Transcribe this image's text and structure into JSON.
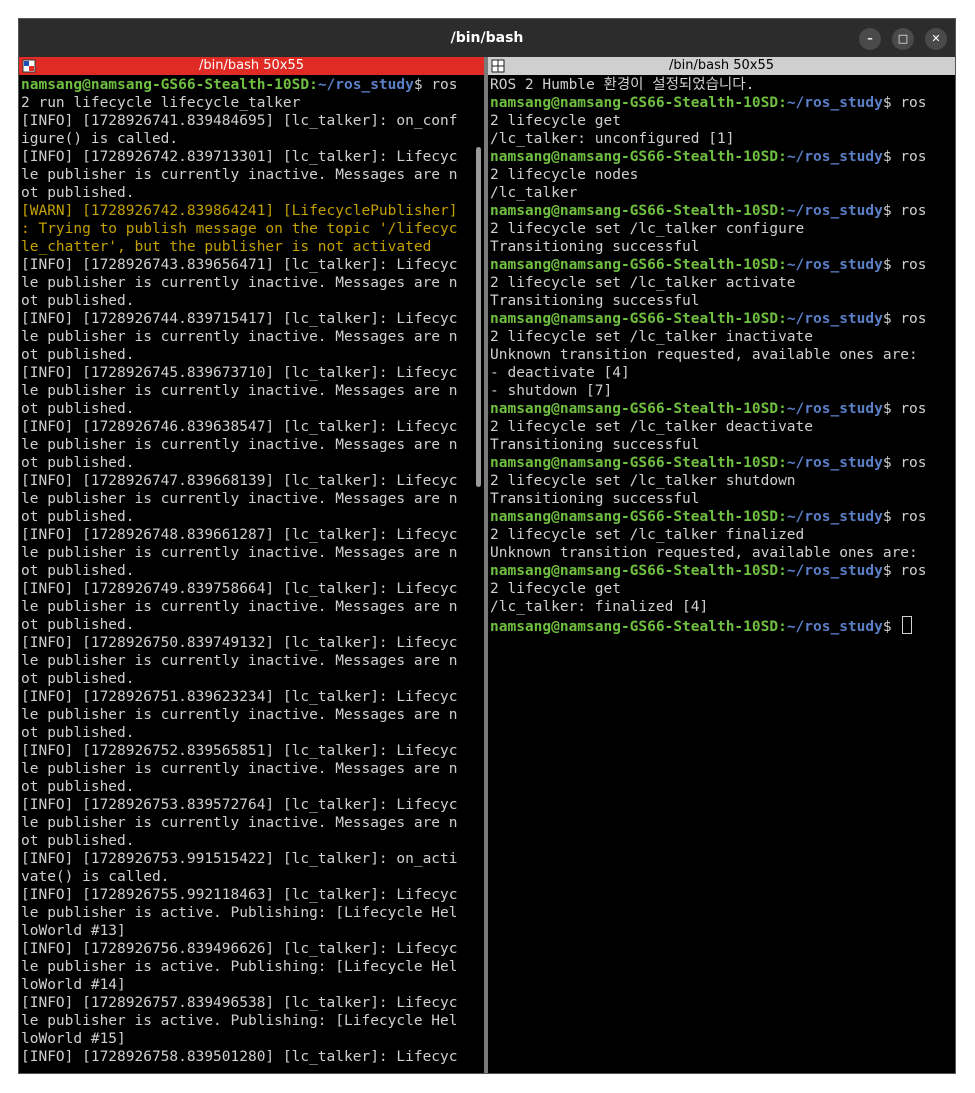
{
  "window": {
    "title": "/bin/bash",
    "buttons": {
      "minimize": "–",
      "maximize": "□",
      "close": "✕"
    }
  },
  "left_pane": {
    "header": "/bin/bash 50x55",
    "active": true,
    "lines": [
      {
        "type": "prompt",
        "user": "namsang@namsang-GS66-Stealth-10SD",
        "sep": ":",
        "path": "~/ros_study",
        "tail": "$ ros"
      },
      {
        "type": "info",
        "text": "2 run lifecycle lifecycle_talker"
      },
      {
        "type": "info",
        "text": "[INFO] [1728926741.839484695] [lc_talker]: on_conf"
      },
      {
        "type": "info",
        "text": "igure() is called."
      },
      {
        "type": "info",
        "text": "[INFO] [1728926742.839713301] [lc_talker]: Lifecyc"
      },
      {
        "type": "info",
        "text": "le publisher is currently inactive. Messages are n"
      },
      {
        "type": "info",
        "text": "ot published."
      },
      {
        "type": "warn",
        "text": "[WARN] [1728926742.839864241] [LifecyclePublisher]"
      },
      {
        "type": "warn",
        "text": ": Trying to publish message on the topic '/lifecyc"
      },
      {
        "type": "warn",
        "text": "le_chatter', but the publisher is not activated"
      },
      {
        "type": "info",
        "text": "[INFO] [1728926743.839656471] [lc_talker]: Lifecyc"
      },
      {
        "type": "info",
        "text": "le publisher is currently inactive. Messages are n"
      },
      {
        "type": "info",
        "text": "ot published."
      },
      {
        "type": "info",
        "text": "[INFO] [1728926744.839715417] [lc_talker]: Lifecyc"
      },
      {
        "type": "info",
        "text": "le publisher is currently inactive. Messages are n"
      },
      {
        "type": "info",
        "text": "ot published."
      },
      {
        "type": "info",
        "text": "[INFO] [1728926745.839673710] [lc_talker]: Lifecyc"
      },
      {
        "type": "info",
        "text": "le publisher is currently inactive. Messages are n"
      },
      {
        "type": "info",
        "text": "ot published."
      },
      {
        "type": "info",
        "text": "[INFO] [1728926746.839638547] [lc_talker]: Lifecyc"
      },
      {
        "type": "info",
        "text": "le publisher is currently inactive. Messages are n"
      },
      {
        "type": "info",
        "text": "ot published."
      },
      {
        "type": "info",
        "text": "[INFO] [1728926747.839668139] [lc_talker]: Lifecyc"
      },
      {
        "type": "info",
        "text": "le publisher is currently inactive. Messages are n"
      },
      {
        "type": "info",
        "text": "ot published."
      },
      {
        "type": "info",
        "text": "[INFO] [1728926748.839661287] [lc_talker]: Lifecyc"
      },
      {
        "type": "info",
        "text": "le publisher is currently inactive. Messages are n"
      },
      {
        "type": "info",
        "text": "ot published."
      },
      {
        "type": "info",
        "text": "[INFO] [1728926749.839758664] [lc_talker]: Lifecyc"
      },
      {
        "type": "info",
        "text": "le publisher is currently inactive. Messages are n"
      },
      {
        "type": "info",
        "text": "ot published."
      },
      {
        "type": "info",
        "text": "[INFO] [1728926750.839749132] [lc_talker]: Lifecyc"
      },
      {
        "type": "info",
        "text": "le publisher is currently inactive. Messages are n"
      },
      {
        "type": "info",
        "text": "ot published."
      },
      {
        "type": "info",
        "text": "[INFO] [1728926751.839623234] [lc_talker]: Lifecyc"
      },
      {
        "type": "info",
        "text": "le publisher is currently inactive. Messages are n"
      },
      {
        "type": "info",
        "text": "ot published."
      },
      {
        "type": "info",
        "text": "[INFO] [1728926752.839565851] [lc_talker]: Lifecyc"
      },
      {
        "type": "info",
        "text": "le publisher is currently inactive. Messages are n"
      },
      {
        "type": "info",
        "text": "ot published."
      },
      {
        "type": "info",
        "text": "[INFO] [1728926753.839572764] [lc_talker]: Lifecyc"
      },
      {
        "type": "info",
        "text": "le publisher is currently inactive. Messages are n"
      },
      {
        "type": "info",
        "text": "ot published."
      },
      {
        "type": "info",
        "text": "[INFO] [1728926753.991515422] [lc_talker]: on_acti"
      },
      {
        "type": "info",
        "text": "vate() is called."
      },
      {
        "type": "info",
        "text": "[INFO] [1728926755.992118463] [lc_talker]: Lifecyc"
      },
      {
        "type": "info",
        "text": "le publisher is active. Publishing: [Lifecycle Hel"
      },
      {
        "type": "info",
        "text": "loWorld #13]"
      },
      {
        "type": "info",
        "text": "[INFO] [1728926756.839496626] [lc_talker]: Lifecyc"
      },
      {
        "type": "info",
        "text": "le publisher is active. Publishing: [Lifecycle Hel"
      },
      {
        "type": "info",
        "text": "loWorld #14]"
      },
      {
        "type": "info",
        "text": "[INFO] [1728926757.839496538] [lc_talker]: Lifecyc"
      },
      {
        "type": "info",
        "text": "le publisher is active. Publishing: [Lifecycle Hel"
      },
      {
        "type": "info",
        "text": "loWorld #15]"
      },
      {
        "type": "info",
        "text": "[INFO] [1728926758.839501280] [lc_talker]: Lifecyc"
      }
    ]
  },
  "right_pane": {
    "header": "/bin/bash 50x55",
    "active": false,
    "lines": [
      {
        "type": "info",
        "text": "ROS 2 Humble 환경이 설정되었습니다."
      },
      {
        "type": "prompt",
        "user": "namsang@namsang-GS66-Stealth-10SD",
        "sep": ":",
        "path": "~/ros_study",
        "tail": "$ ros"
      },
      {
        "type": "info",
        "text": "2 lifecycle get"
      },
      {
        "type": "info",
        "text": "/lc_talker: unconfigured [1]"
      },
      {
        "type": "prompt",
        "user": "namsang@namsang-GS66-Stealth-10SD",
        "sep": ":",
        "path": "~/ros_study",
        "tail": "$ ros"
      },
      {
        "type": "info",
        "text": "2 lifecycle nodes"
      },
      {
        "type": "info",
        "text": "/lc_talker"
      },
      {
        "type": "prompt",
        "user": "namsang@namsang-GS66-Stealth-10SD",
        "sep": ":",
        "path": "~/ros_study",
        "tail": "$ ros"
      },
      {
        "type": "info",
        "text": "2 lifecycle set /lc_talker configure"
      },
      {
        "type": "info",
        "text": "Transitioning successful"
      },
      {
        "type": "prompt",
        "user": "namsang@namsang-GS66-Stealth-10SD",
        "sep": ":",
        "path": "~/ros_study",
        "tail": "$ ros"
      },
      {
        "type": "info",
        "text": "2 lifecycle set /lc_talker activate"
      },
      {
        "type": "info",
        "text": "Transitioning successful"
      },
      {
        "type": "prompt",
        "user": "namsang@namsang-GS66-Stealth-10SD",
        "sep": ":",
        "path": "~/ros_study",
        "tail": "$ ros"
      },
      {
        "type": "info",
        "text": "2 lifecycle set /lc_talker inactivate"
      },
      {
        "type": "info",
        "text": "Unknown transition requested, available ones are:"
      },
      {
        "type": "info",
        "text": "- deactivate [4]"
      },
      {
        "type": "info",
        "text": "- shutdown [7]"
      },
      {
        "type": "prompt",
        "user": "namsang@namsang-GS66-Stealth-10SD",
        "sep": ":",
        "path": "~/ros_study",
        "tail": "$ ros"
      },
      {
        "type": "info",
        "text": "2 lifecycle set /lc_talker deactivate"
      },
      {
        "type": "info",
        "text": "Transitioning successful"
      },
      {
        "type": "prompt",
        "user": "namsang@namsang-GS66-Stealth-10SD",
        "sep": ":",
        "path": "~/ros_study",
        "tail": "$ ros"
      },
      {
        "type": "info",
        "text": "2 lifecycle set /lc_talker shutdown"
      },
      {
        "type": "info",
        "text": "Transitioning successful"
      },
      {
        "type": "prompt",
        "user": "namsang@namsang-GS66-Stealth-10SD",
        "sep": ":",
        "path": "~/ros_study",
        "tail": "$ ros"
      },
      {
        "type": "info",
        "text": "2 lifecycle set /lc_talker finalized"
      },
      {
        "type": "info",
        "text": "Unknown transition requested, available ones are:"
      },
      {
        "type": "prompt",
        "user": "namsang@namsang-GS66-Stealth-10SD",
        "sep": ":",
        "path": "~/ros_study",
        "tail": "$ ros"
      },
      {
        "type": "info",
        "text": "2 lifecycle get"
      },
      {
        "type": "info",
        "text": "/lc_talker: finalized [4]"
      },
      {
        "type": "prompt",
        "user": "namsang@namsang-GS66-Stealth-10SD",
        "sep": ":",
        "path": "~/ros_study",
        "tail": "$ ",
        "cursor": true
      }
    ]
  },
  "colors": {
    "active_header": "#df2b24",
    "inactive_header": "#cfcfcf",
    "prompt_user": "#6fbf40",
    "prompt_path": "#5a7fc7",
    "warn": "#c4a000",
    "text": "#d0d0d0"
  },
  "icons": {
    "left_pane": "split-pane-icon",
    "right_pane": "split-pane-icon"
  }
}
